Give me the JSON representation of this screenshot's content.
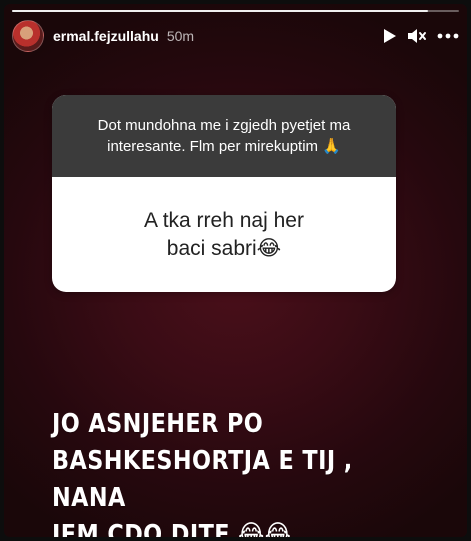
{
  "story": {
    "progress": 0.93,
    "header": {
      "username": "ermal.fejzullahu",
      "time": "50m",
      "icons": [
        "play-icon",
        "mute-icon",
        "more-icon"
      ]
    },
    "question_sticker": {
      "prompt_line1": "Dot mundohna me i zgjedh pyetjet ma",
      "prompt_line2": "interesante. Flm per mirekuptim 🙏",
      "question_line1": "A tka rreh naj her",
      "question_line2": "baci sabri😂"
    },
    "answer": {
      "line1": "JO ASNJEHER PO",
      "line2": "BASHKESHORTJA E TIJ , NANA",
      "line3": "JEM CDO DITE 😂😂"
    }
  }
}
